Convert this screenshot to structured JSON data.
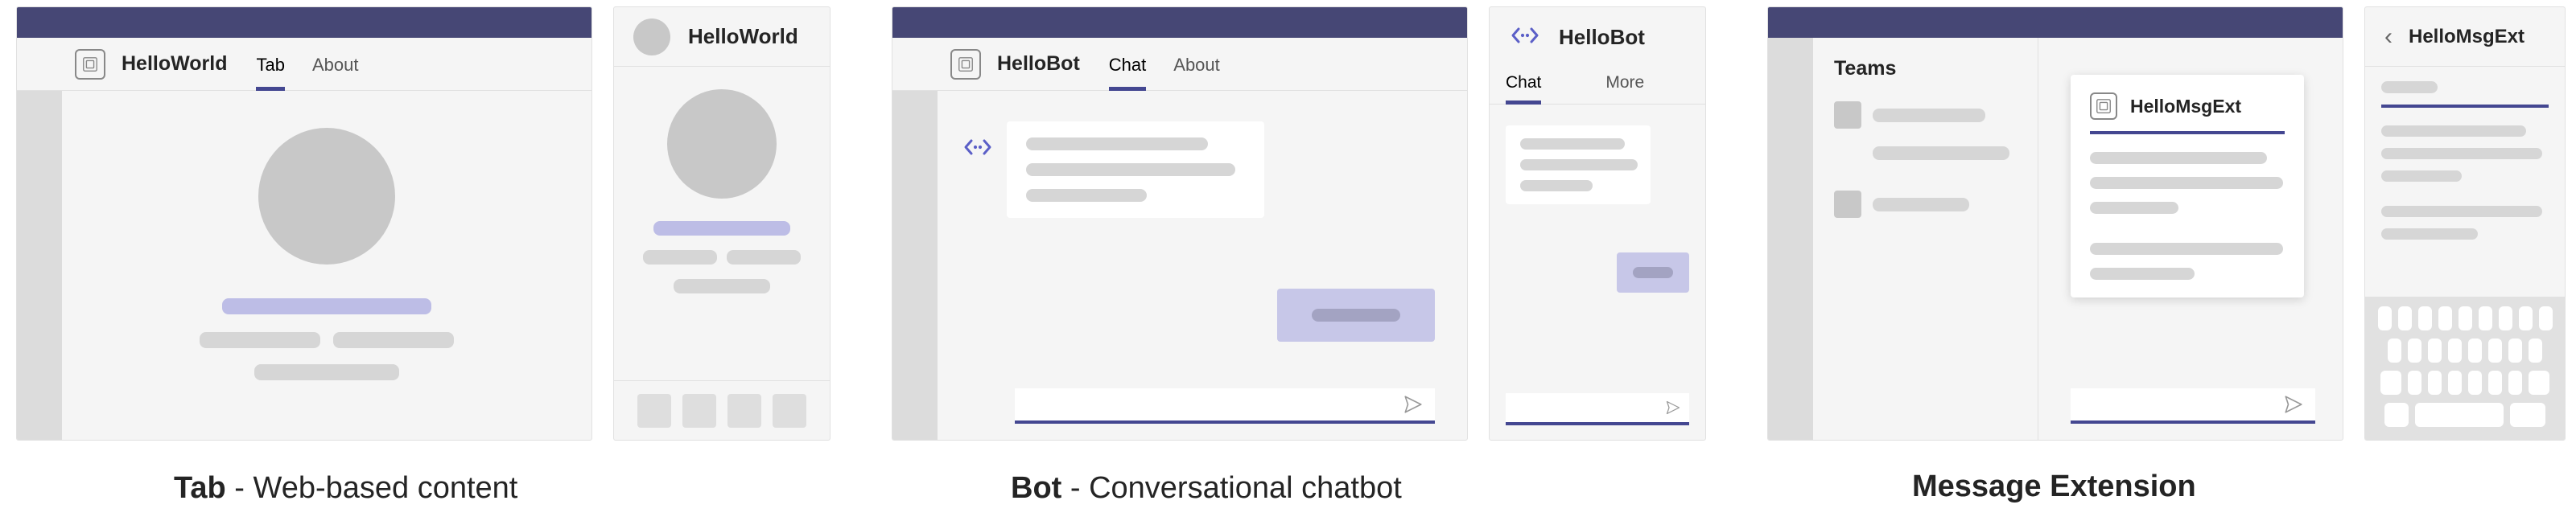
{
  "panels": {
    "tab": {
      "app_name": "HelloWorld",
      "tabs": [
        "Tab",
        "About"
      ],
      "active_tab_index": 0,
      "mobile_title": "HelloWorld"
    },
    "bot": {
      "app_name": "HelloBot",
      "tabs": [
        "Chat",
        "About"
      ],
      "active_tab_index": 0,
      "mobile_title": "HelloBot",
      "mobile_tabs": [
        "Chat",
        "More"
      ],
      "mobile_active_index": 0
    },
    "msgext": {
      "sidebar_title": "Teams",
      "card_title": "HelloMsgExt",
      "mobile_title": "HelloMsgExt"
    }
  },
  "captions": {
    "tab_bold": "Tab",
    "tab_rest": " - Web-based content",
    "bot_bold": "Bot",
    "bot_rest": " - Conversational chatbot",
    "msgext": "Message Extension"
  }
}
